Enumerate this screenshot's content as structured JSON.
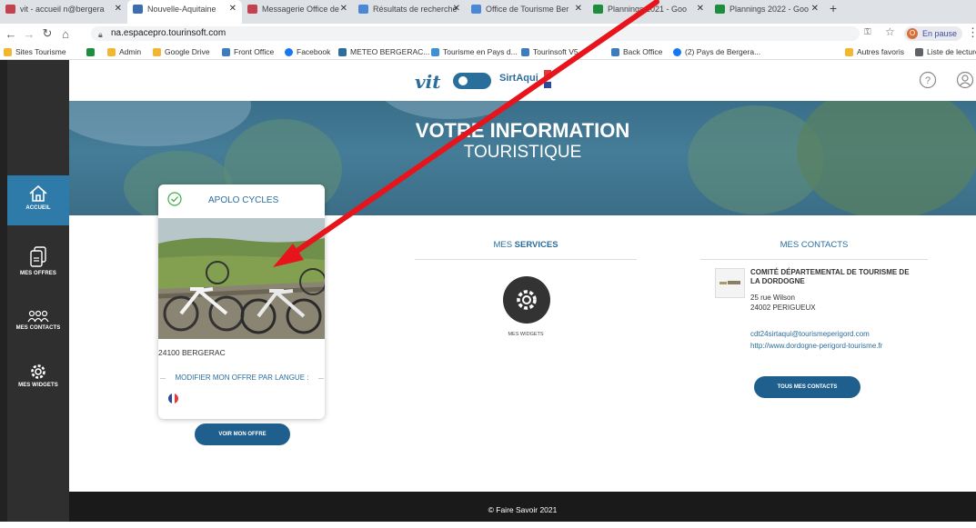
{
  "browser": {
    "tabs": [
      {
        "label": "vit - accueil n@bergera",
        "color": "#c4424f"
      },
      {
        "label": "Nouvelle-Aquitaine",
        "color": "#3e6db0"
      },
      {
        "label": "Messagerie Office de",
        "color": "#c4424f"
      },
      {
        "label": "Résultats de recherche",
        "color": "#4a88d6"
      },
      {
        "label": "Office de Tourisme Ber",
        "color": "#4a88d6"
      },
      {
        "label": "Plannings 2021 - Goo",
        "color": "#1e8e3e"
      },
      {
        "label": "Plannings 2022 - Goo",
        "color": "#1e8e3e"
      }
    ],
    "new_tab": "+",
    "url": "na.espacepro.tourinsoft.com",
    "profile_initial": "O",
    "profile_label": "En pause",
    "bookmarks": [
      {
        "label": "Sites Tourisme",
        "color": "#f2b631"
      },
      {
        "label": "",
        "color": "#1e8e3e"
      },
      {
        "label": "Admin",
        "color": "#f2b631"
      },
      {
        "label": "Google Drive",
        "color": "#f2b631"
      },
      {
        "label": "Front Office",
        "color": "#3c7ebd"
      },
      {
        "label": "Facebook",
        "color": "#1877f2"
      },
      {
        "label": "METEO BERGERAC...",
        "color": "#2a6e9c"
      },
      {
        "label": "Tourisme en Pays d...",
        "color": "#3e91d6"
      },
      {
        "label": "Tourinsoft V5...",
        "color": "#3c7ebd"
      },
      {
        "label": "Back Office",
        "color": "#3c7ebd"
      },
      {
        "label": "(2) Pays de Bergera...",
        "color": "#1877f2"
      }
    ],
    "bookmarks_right": [
      {
        "label": "Autres favoris",
        "color": "#f2b631"
      },
      {
        "label": "Liste de lecture",
        "color": "#5f6368"
      }
    ]
  },
  "sidebar": {
    "items": [
      {
        "label": "ACCUEIL",
        "icon": "home-icon"
      },
      {
        "label": "MES OFFRES",
        "icon": "documents-icon"
      },
      {
        "label": "MES CONTACTS",
        "icon": "people-icon"
      },
      {
        "label": "MES WIDGETS",
        "icon": "gear-icon"
      }
    ]
  },
  "header": {
    "logo_text": "vit",
    "logo_text2": "SirtAqui"
  },
  "hero": {
    "title": "VOTRE INFORMATION",
    "subtitle": "TOURISTIQUE"
  },
  "offer_card": {
    "name": "APOLO CYCLES",
    "city": "24100 BERGERAC",
    "modify_label": "MODIFIER MON OFFRE PAR LANGUE :",
    "button": "VOIR MON OFFRE"
  },
  "services": {
    "title_prefix": "MES",
    "title_bold": "SERVICES",
    "widget_label": "MES WIDGETS"
  },
  "contacts": {
    "title": "MES CONTACTS",
    "name": "COMITÉ DÉPARTEMENTAL DE TOURISME DE LA DORDOGNE",
    "address1": "25 rue Wilson",
    "address2": "24002 PERIGUEUX",
    "email": "cdt24sirtaqui@tourismeperigord.com",
    "website": "http://www.dordogne-perigord-tourisme.fr",
    "button": "TOUS MES CONTACTS"
  },
  "footer": {
    "text": "© Faire Savoir 2021"
  },
  "colors": {
    "brand": "#2a6e9c",
    "button": "#1f5f8e",
    "sidebar": "#2f2f2f",
    "sidebar_active": "#2e7aa8",
    "arrow": "#e8141b"
  }
}
